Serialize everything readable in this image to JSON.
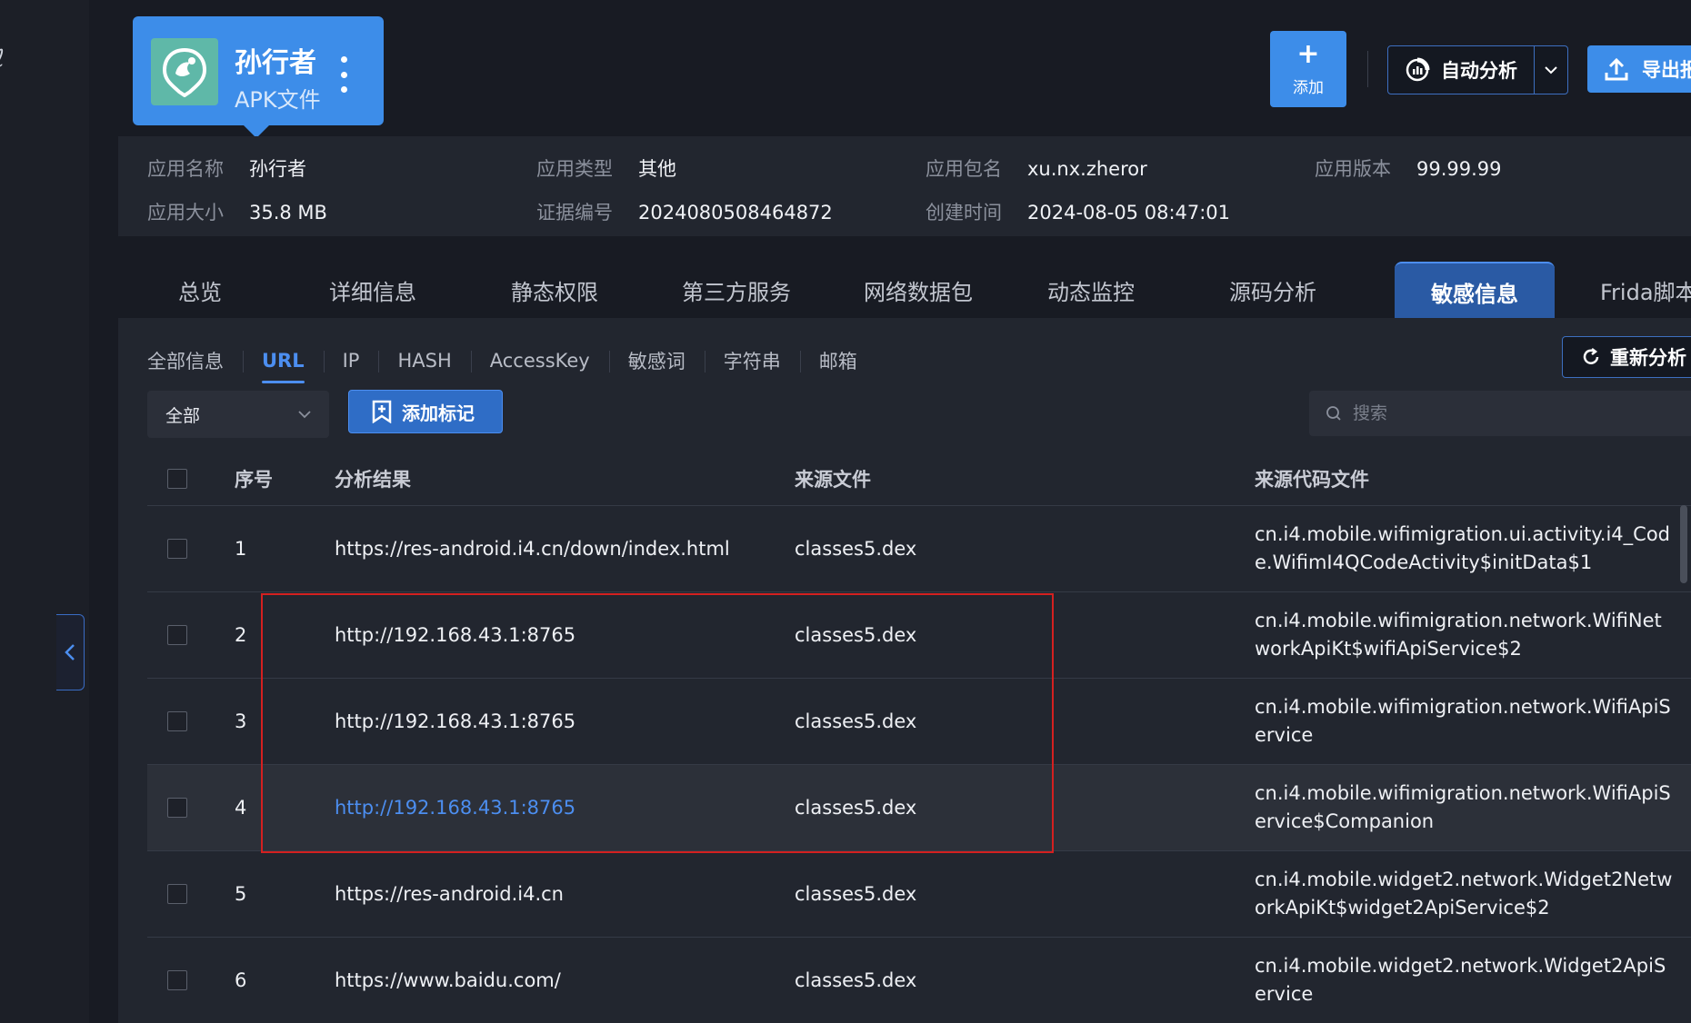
{
  "sidebar": {
    "cut_text": "ℓ"
  },
  "app": {
    "name": "孙行者",
    "type": "APK文件"
  },
  "header": {
    "add_label": "添加",
    "auto_analyze_label": "自动分析",
    "export_label": "导出报"
  },
  "info": {
    "app_name_key": "应用名称",
    "app_name_val": "孙行者",
    "app_type_key": "应用类型",
    "app_type_val": "其他",
    "package_key": "应用包名",
    "package_val": "xu.nx.zheror",
    "version_key": "应用版本",
    "version_val": "99.99.99",
    "size_key": "应用大小",
    "size_val": "35.8 MB",
    "cert_key": "证据编号",
    "cert_val": "2024080508464872",
    "created_key": "创建时间",
    "created_val": "2024-08-05 08:47:01"
  },
  "tabs": [
    "总览",
    "详细信息",
    "静态权限",
    "第三方服务",
    "网络数据包",
    "动态监控",
    "源码分析",
    "敏感信息",
    "Frida脚本"
  ],
  "active_tab": "敏感信息",
  "subtabs": [
    "全部信息",
    "URL",
    "IP",
    "HASH",
    "AccessKey",
    "敏感词",
    "字符串",
    "邮箱"
  ],
  "active_subtab": "URL",
  "toolbar": {
    "reanalyze_label": "重新分析",
    "filter_value": "全部",
    "add_mark_label": "添加标记",
    "search_placeholder": "搜索"
  },
  "table": {
    "headers": {
      "index": "序号",
      "result": "分析结果",
      "source_file": "来源文件",
      "source_code": "来源代码文件"
    },
    "rows": [
      {
        "index": "1",
        "result": "https://res-android.i4.cn/down/index.html",
        "source_file": "classes5.dex",
        "source_code": "cn.i4.mobile.wifimigration.ui.activity.i4_Code.WifimI4QCodeActivity$initData$1"
      },
      {
        "index": "2",
        "result": "http://192.168.43.1:8765",
        "source_file": "classes5.dex",
        "source_code": "cn.i4.mobile.wifimigration.network.WifiNetworkApiKt$wifiApiService$2"
      },
      {
        "index": "3",
        "result": "http://192.168.43.1:8765",
        "source_file": "classes5.dex",
        "source_code": "cn.i4.mobile.wifimigration.network.WifiApiService"
      },
      {
        "index": "4",
        "result": "http://192.168.43.1:8765",
        "source_file": "classes5.dex",
        "source_code": "cn.i4.mobile.wifimigration.network.WifiApiService$Companion"
      },
      {
        "index": "5",
        "result": "https://res-android.i4.cn",
        "source_file": "classes5.dex",
        "source_code": "cn.i4.mobile.widget2.network.Widget2NetworkApiKt$widget2ApiService$2"
      },
      {
        "index": "6",
        "result": "https://www.baidu.com/",
        "source_file": "classes5.dex",
        "source_code": "cn.i4.mobile.widget2.network.Widget2ApiService"
      }
    ]
  },
  "colors": {
    "accent": "#3d8de9",
    "link": "#4c8ef0",
    "highlight": "#d42020"
  }
}
